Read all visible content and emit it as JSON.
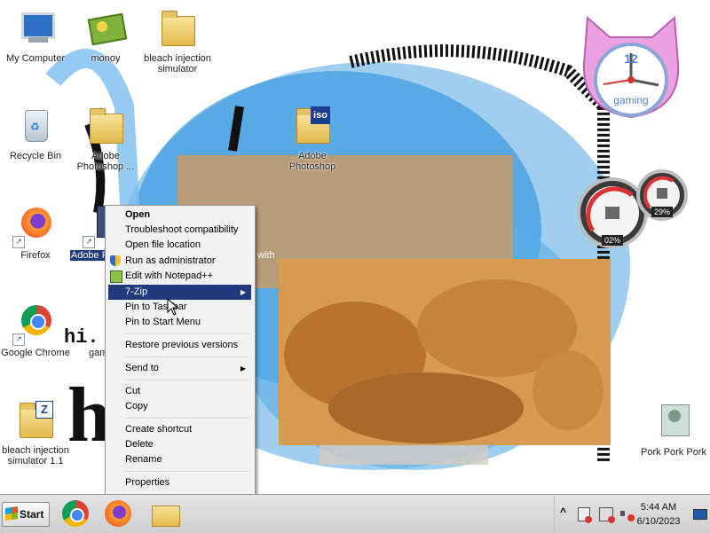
{
  "desktop_icons": [
    {
      "label": "My Computer"
    },
    {
      "label": "monoy"
    },
    {
      "label": "bleach injection simulator"
    },
    {
      "label": "Recycle Bin"
    },
    {
      "label": "Adobe Photoshop ..."
    },
    {
      "label": "Adobe Photoshop"
    },
    {
      "label": "Firefox"
    },
    {
      "label": "Adobe Photos..."
    },
    {
      "label": "Google Chrome"
    },
    {
      "label": "bleach injection simulator 1.1"
    },
    {
      "label": "Pork Pork Pork"
    }
  ],
  "iso_badge": "iso",
  "partial_label_with": "with",
  "partial_label_gam": "gam",
  "wallpaper_text_hi": "hi.",
  "wallpaper_text_h": "h",
  "clock_gadget": {
    "number": "12",
    "label": "gaming"
  },
  "meter_gadget": {
    "cpu": "02%",
    "memory": "29%"
  },
  "context_menu": {
    "items": [
      {
        "label": "Open",
        "bold": true
      },
      {
        "label": "Troubleshoot compatibility"
      },
      {
        "label": "Open file location"
      },
      {
        "label": "Run as administrator"
      },
      {
        "label": "Edit with Notepad++"
      },
      {
        "label": "7-Zip",
        "submenu": true,
        "selected": true
      },
      {
        "label": "Pin to Taskbar"
      },
      {
        "label": "Pin to Start Menu"
      },
      {
        "label": "Restore previous versions"
      },
      {
        "label": "Send to",
        "submenu": true
      },
      {
        "label": "Cut"
      },
      {
        "label": "Copy"
      },
      {
        "label": "Create shortcut"
      },
      {
        "label": "Delete"
      },
      {
        "label": "Rename"
      },
      {
        "label": "Properties"
      }
    ]
  },
  "taskbar": {
    "start_label": "Start",
    "clock_time": "5:44 AM",
    "clock_date": "6/10/2023",
    "tray_expand": "^"
  },
  "colors": {
    "menu_highlight": "#1f3a7d",
    "wallpaper_blue": "#2a8fd8",
    "gadget_pink": "#e08ad8"
  }
}
